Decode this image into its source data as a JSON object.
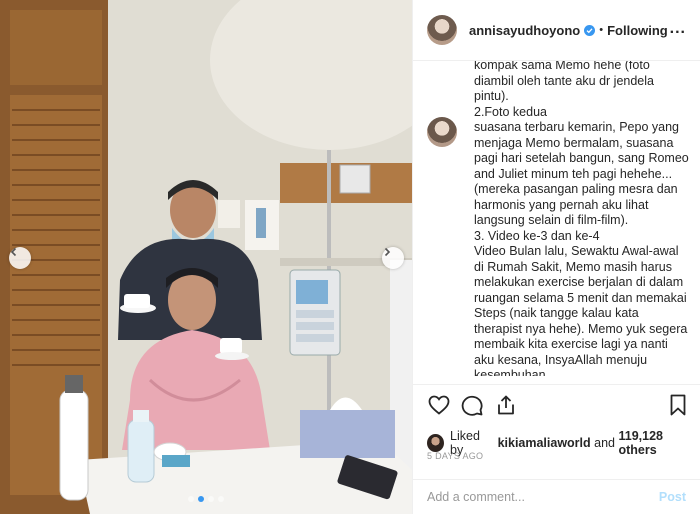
{
  "header": {
    "username": "annisayudhoyono",
    "separator": "•",
    "follow_state": "Following",
    "more_label": "..."
  },
  "caption": {
    "first_block": "kompak sama Memo hehe (foto\ndiambil oleh tante aku dr jendela\npintu).\n2.Foto kedua",
    "second_block": "suasana terbaru kemarin, Pepo yang\nmenjaga Memo bermalam, suasana\npagi hari setelah bangun, sang Romeo\nand Juliet minum teh pagi hehehe...\n(mereka pasangan paling mesra dan\nharmonis yang pernah aku lihat\nlangsung selain di film-film).\n3. Video ke-3 dan ke-4\nVideo Bulan lalu, Sewaktu Awal-awal\ndi Rumah Sakit, Memo masih harus\nmelakukan exercise berjalan di dalam\nruangan selama 5 menit dan memakai\nSteps (naik tangge kalau kata\ntherapist nya hehe). Memo yuk segera\nmembaik kita exercise lagi ya nanti\naku kesana, InsyaAllah menuju\nkesembuhan"
  },
  "actions": {
    "like_icon": "heart-icon",
    "comment_icon": "speech-bubble-icon",
    "share_icon": "share-icon",
    "save_icon": "bookmark-icon"
  },
  "likes": {
    "prefix": "Liked by",
    "user": "kikiamaliaworld",
    "middle": "and",
    "count": "119,128 others"
  },
  "timestamp": "5 DAYS AGO",
  "comment_box": {
    "placeholder": "Add a comment...",
    "post_label": "Post"
  },
  "carousel": {
    "total_slides": 4,
    "active_slide": 2
  },
  "colors": {
    "accent": "#3897f0",
    "post_disabled": "#b2dffc",
    "muted": "#999999"
  }
}
